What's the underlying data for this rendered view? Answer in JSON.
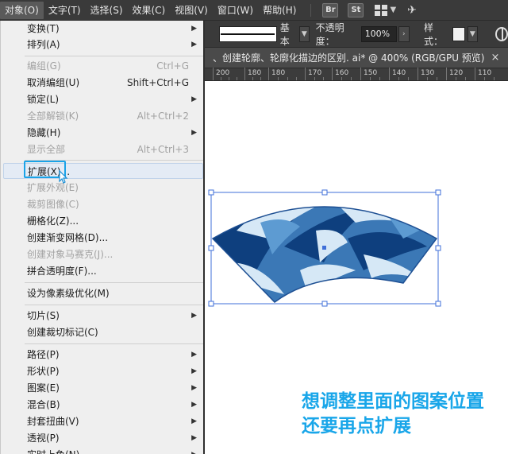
{
  "menubar": {
    "items": [
      "对象(O)",
      "文字(T)",
      "选择(S)",
      "效果(C)",
      "视图(V)",
      "窗口(W)",
      "帮助(H)"
    ],
    "app_buttons": [
      "Br",
      "St"
    ]
  },
  "control_bar": {
    "stroke_style": "基本",
    "opacity_label": "不透明度：",
    "opacity_value": "100%",
    "style_label": "样式："
  },
  "document_tab": {
    "title": "、创建轮廓、轮廓化描边的区别. ai* @ 400% (RGB/GPU 预览)",
    "close": "×"
  },
  "ruler": {
    "labels": [
      "200",
      "180",
      "180",
      "170",
      "160",
      "150",
      "140",
      "130",
      "120",
      "110"
    ]
  },
  "menu": {
    "items": [
      {
        "label": "变换(T)",
        "shortcut": "",
        "submenu": true,
        "disabled": false
      },
      {
        "label": "排列(A)",
        "shortcut": "",
        "submenu": true,
        "disabled": false
      },
      {
        "label": "编组(G)",
        "shortcut": "Ctrl+G",
        "submenu": false,
        "disabled": true
      },
      {
        "label": "取消编组(U)",
        "shortcut": "Shift+Ctrl+G",
        "submenu": false,
        "disabled": false
      },
      {
        "label": "锁定(L)",
        "shortcut": "",
        "submenu": true,
        "disabled": false
      },
      {
        "label": "全部解锁(K)",
        "shortcut": "Alt+Ctrl+2",
        "submenu": false,
        "disabled": true
      },
      {
        "label": "隐藏(H)",
        "shortcut": "",
        "submenu": true,
        "disabled": false
      },
      {
        "label": "显示全部",
        "shortcut": "Alt+Ctrl+3",
        "submenu": false,
        "disabled": true
      },
      {
        "label": "扩展(X)...",
        "shortcut": "",
        "submenu": false,
        "disabled": false
      },
      {
        "label": "扩展外观(E)",
        "shortcut": "",
        "submenu": false,
        "disabled": true
      },
      {
        "label": "裁剪图像(C)",
        "shortcut": "",
        "submenu": false,
        "disabled": true
      },
      {
        "label": "栅格化(Z)...",
        "shortcut": "",
        "submenu": false,
        "disabled": false
      },
      {
        "label": "创建渐变网格(D)...",
        "shortcut": "",
        "submenu": false,
        "disabled": false
      },
      {
        "label": "创建对象马赛克(J)...",
        "shortcut": "",
        "submenu": false,
        "disabled": true
      },
      {
        "label": "拼合透明度(F)...",
        "shortcut": "",
        "submenu": false,
        "disabled": false
      },
      {
        "label": "设为像素级优化(M)",
        "shortcut": "",
        "submenu": false,
        "disabled": false
      },
      {
        "label": "切片(S)",
        "shortcut": "",
        "submenu": true,
        "disabled": false
      },
      {
        "label": "创建裁切标记(C)",
        "shortcut": "",
        "submenu": false,
        "disabled": false
      },
      {
        "label": "路径(P)",
        "shortcut": "",
        "submenu": true,
        "disabled": false
      },
      {
        "label": "形状(P)",
        "shortcut": "",
        "submenu": true,
        "disabled": false
      },
      {
        "label": "图案(E)",
        "shortcut": "",
        "submenu": true,
        "disabled": false
      },
      {
        "label": "混合(B)",
        "shortcut": "",
        "submenu": true,
        "disabled": false
      },
      {
        "label": "封套扭曲(V)",
        "shortcut": "",
        "submenu": true,
        "disabled": false
      },
      {
        "label": "透视(P)",
        "shortcut": "",
        "submenu": true,
        "disabled": false
      },
      {
        "label": "实时上色(N)",
        "shortcut": "",
        "submenu": true,
        "disabled": false
      }
    ]
  },
  "caption": {
    "line1": "想调整里面的图案位置",
    "line2": "还要再点扩展"
  },
  "colors": {
    "accent": "#19a6e9",
    "highlight_border": "#1aa3e8",
    "selection_box": "#3f6fd8",
    "art_dark": "#0e3f7e",
    "art_mid": "#3b78b6",
    "art_light": "#d6e8f6"
  }
}
